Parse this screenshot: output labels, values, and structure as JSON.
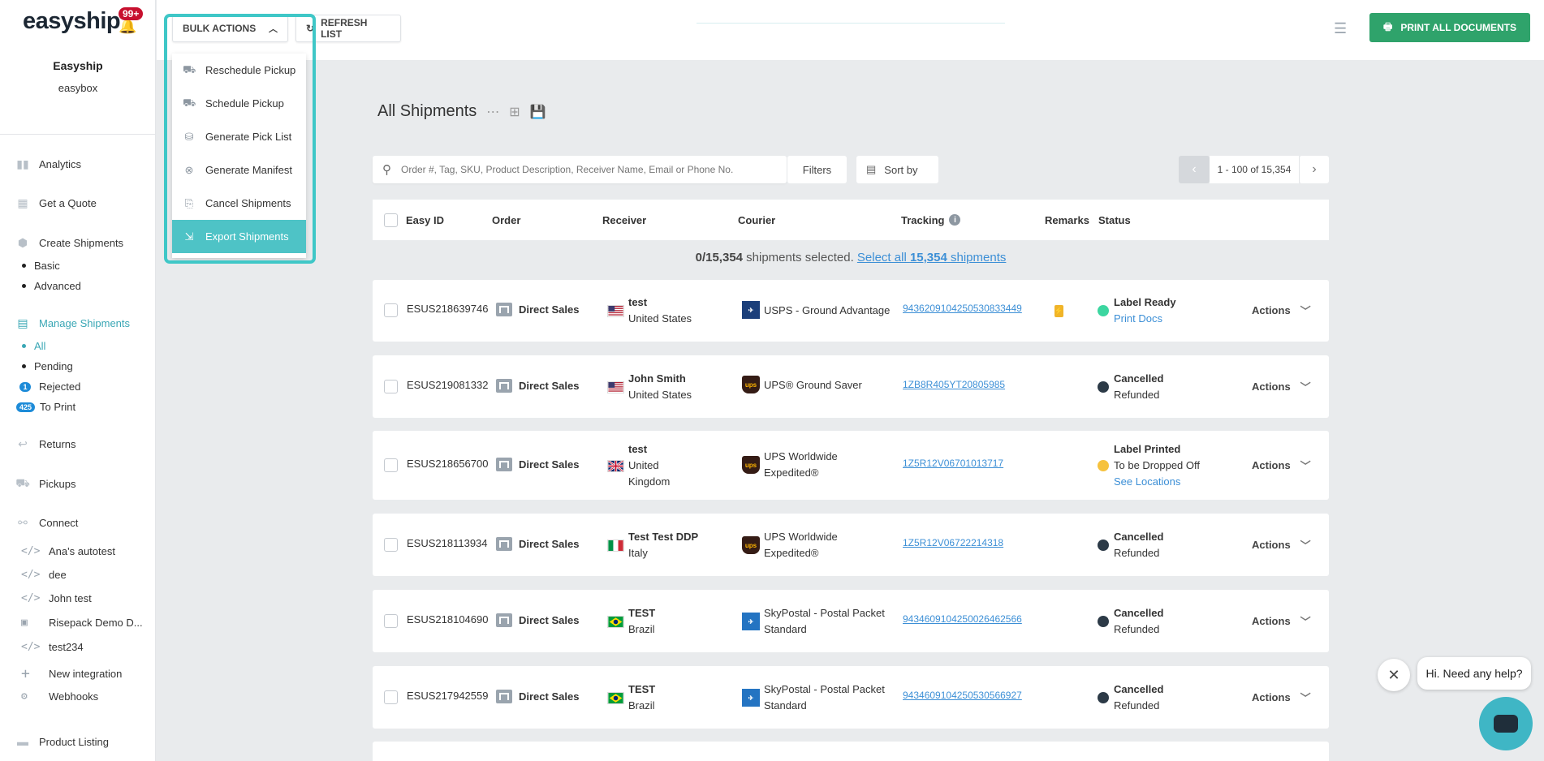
{
  "sidebar": {
    "logo": "easyship",
    "badge": "99+",
    "account_name": "Easyship",
    "account_sub": "easybox",
    "nav": {
      "analytics": "Analytics",
      "quote": "Get a Quote",
      "create": "Create Shipments",
      "create_basic": "Basic",
      "create_advanced": "Advanced",
      "manage": "Manage Shipments",
      "manage_all": "All",
      "manage_pending": "Pending",
      "manage_rejected": "Rejected",
      "rejected_count": "1",
      "manage_toprint": "To Print",
      "toprint_count": "425",
      "returns": "Returns",
      "pickups": "Pickups",
      "connect": "Connect",
      "integrations": [
        "Ana's autotest",
        "dee",
        "John test",
        "Risepack Demo D...",
        "test234"
      ],
      "new_integration": "New integration",
      "webhooks": "Webhooks",
      "product_listing": "Product Listing"
    }
  },
  "topbar": {
    "bulk_actions": "BULK ACTIONS",
    "refresh": "REFRESH LIST",
    "print_all": "PRINT ALL DOCUMENTS"
  },
  "bulk_menu": [
    "Reschedule Pickup",
    "Schedule Pickup",
    "Generate Pick List",
    "Generate Manifest",
    "Cancel Shipments",
    "Export Shipments"
  ],
  "main": {
    "title": "All Shipments",
    "search_placeholder": "Order #, Tag, SKU, Product Description, Receiver Name, Email or Phone No.",
    "filters": "Filters",
    "sort_by": "Sort by",
    "pager": "1 - 100 of 15,354",
    "columns": {
      "easy_id": "Easy ID",
      "order": "Order",
      "receiver": "Receiver",
      "courier": "Courier",
      "tracking": "Tracking",
      "remarks": "Remarks",
      "status": "Status"
    },
    "selection": {
      "count": "0/15,354",
      "text": " shipments selected. ",
      "link_pre": "Select all ",
      "link_num": "15,354",
      "link_post": " shipments"
    },
    "actions_label": "Actions",
    "rows": [
      {
        "id": "ESUS218639746",
        "order": "Direct Sales",
        "name": "test",
        "country": "United States",
        "courier": "USPS - Ground Advantage",
        "tracking": "9436209104250530833449",
        "status": "Label Ready",
        "status_sub": "Print Docs"
      },
      {
        "id": "ESUS219081332",
        "order": "Direct Sales",
        "name": "John Smith",
        "country": "United States",
        "courier": "UPS® Ground Saver",
        "tracking": "1ZB8R405YT20805985",
        "status": "Cancelled",
        "status_sub": "Refunded"
      },
      {
        "id": "ESUS218656700",
        "order": "Direct Sales",
        "name": "test",
        "country_l1": "United",
        "country_l2": "Kingdom",
        "courier_l1": "UPS Worldwide",
        "courier_l2": "Expedited®",
        "tracking": "1Z5R12V06701013717",
        "status": "Label Printed",
        "status_sub": "To be Dropped Off",
        "status_link": "See Locations"
      },
      {
        "id": "ESUS218113934",
        "order": "Direct Sales",
        "name": "Test Test DDP",
        "country": "Italy",
        "courier_l1": "UPS Worldwide",
        "courier_l2": "Expedited®",
        "tracking": "1Z5R12V06722214318",
        "status": "Cancelled",
        "status_sub": "Refunded"
      },
      {
        "id": "ESUS218104690",
        "order": "Direct Sales",
        "name": "TEST",
        "country": "Brazil",
        "courier_l1": "SkyPostal - Postal Packet",
        "courier_l2": "Standard",
        "tracking": "9434609104250026462566",
        "status": "Cancelled",
        "status_sub": "Refunded"
      },
      {
        "id": "ESUS217942559",
        "order": "Direct Sales",
        "name": "TEST",
        "country": "Brazil",
        "courier_l1": "SkyPostal - Postal Packet",
        "courier_l2": "Standard",
        "tracking": "9434609104250530566927",
        "status": "Cancelled",
        "status_sub": "Refunded"
      }
    ]
  },
  "chat": {
    "bubble": "Hi. Need any help?"
  },
  "colors": {
    "accent": "#3fc7c7",
    "print_button": "#2fa36b",
    "link": "#3c8fd6",
    "status_ready": "#3cd6a0",
    "status_printed": "#f6c23e",
    "status_cancelled": "#2c3a47"
  }
}
